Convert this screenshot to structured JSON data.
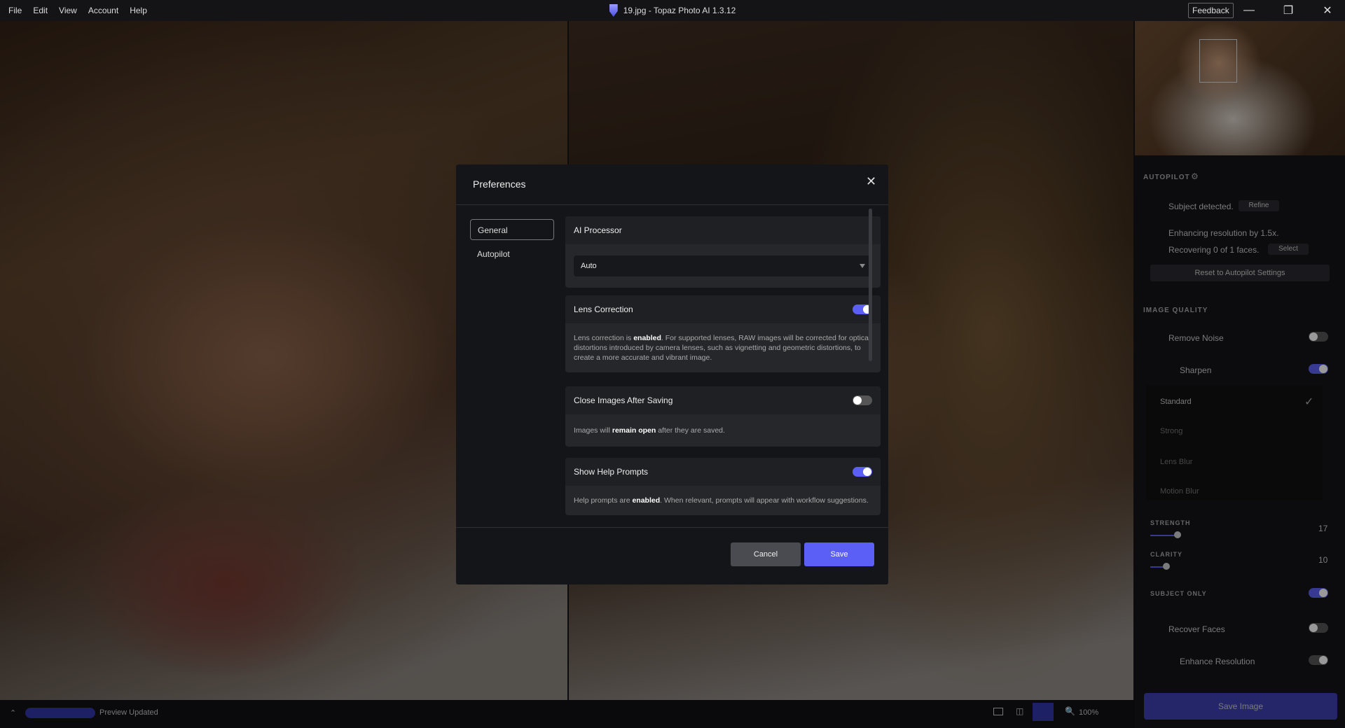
{
  "menu": [
    "File",
    "Edit",
    "View",
    "Account",
    "Help"
  ],
  "window_title": "19.jpg - Topaz Photo AI 1.3.12",
  "feedback": "Feedback",
  "right_panel": {
    "autopilot_heading": "AUTOPILOT",
    "subject_detected": "Subject detected.",
    "refine": "Refine",
    "enhancing": "Enhancing resolution by 1.5x.",
    "recovering": "Recovering 0 of 1 faces.",
    "select": "Select",
    "reset": "Reset to Autopilot Settings",
    "image_quality": "IMAGE QUALITY",
    "remove_noise": "Remove Noise",
    "sharpen": "Sharpen",
    "sharpen_modes": [
      "Standard",
      "Strong",
      "Lens Blur",
      "Motion Blur"
    ],
    "strength_label": "STRENGTH",
    "strength": "17",
    "clarity_label": "CLARITY",
    "clarity": "10",
    "subject_only": "SUBJECT ONLY",
    "recover_faces": "Recover Faces",
    "enhance_resolution": "Enhance Resolution",
    "save_image": "Save Image"
  },
  "status": {
    "preview": "Preview Updated",
    "zoom": "100%"
  },
  "dialog": {
    "title": "Preferences",
    "nav": [
      "General",
      "Autopilot"
    ],
    "ai_processor": {
      "title": "AI Processor",
      "value": "Auto"
    },
    "lens": {
      "title": "Lens Correction",
      "enabled": true,
      "pre": "Lens correction is ",
      "bold": "enabled",
      "post": ". For supported lenses, RAW images will be corrected for optical distortions introduced by camera lenses, such as vignetting and geometric distortions, to create a more accurate and vibrant image."
    },
    "close_after": {
      "title": "Close Images After Saving",
      "enabled": false,
      "pre": "Images will ",
      "bold": "remain open",
      "post": " after they are saved."
    },
    "help": {
      "title": "Show Help Prompts",
      "enabled": true,
      "pre": "Help prompts are ",
      "bold": "enabled",
      "post": ". When relevant, prompts will appear with workflow suggestions."
    },
    "cancel": "Cancel",
    "save": "Save"
  },
  "colors": {
    "accent": "#5b5ff5"
  }
}
